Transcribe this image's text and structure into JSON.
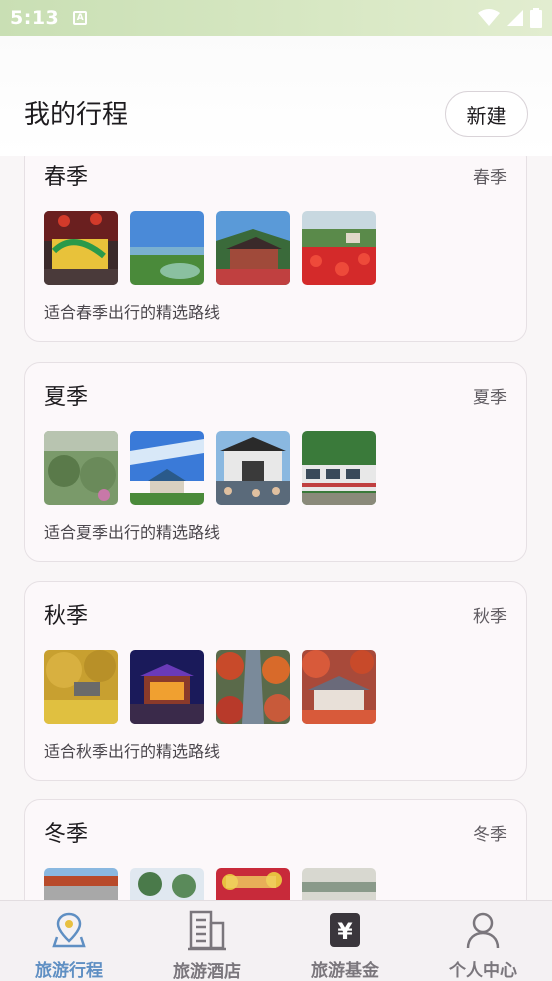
{
  "status_bar": {
    "time": "5:13"
  },
  "header": {
    "title": "我的行程",
    "new_button": "新建"
  },
  "seasons": [
    {
      "name": "春季",
      "tag": "春季",
      "description": "适合春季出行的精选路线"
    },
    {
      "name": "夏季",
      "tag": "夏季",
      "description": "适合夏季出行的精选路线"
    },
    {
      "name": "秋季",
      "tag": "秋季",
      "description": "适合秋季出行的精选路线"
    },
    {
      "name": "冬季",
      "tag": "冬季",
      "description": ""
    }
  ],
  "bottom_nav": [
    {
      "label": "旅游行程",
      "icon": "map-pin-icon",
      "active": true
    },
    {
      "label": "旅游酒店",
      "icon": "building-icon",
      "active": false
    },
    {
      "label": "旅游基金",
      "icon": "yen-wallet-icon",
      "active": false
    },
    {
      "label": "个人中心",
      "icon": "person-icon",
      "active": false
    }
  ],
  "colors": {
    "accent": "#5f8fc3",
    "inactive": "#7a767c",
    "status_bar": "#d3e5bf"
  }
}
